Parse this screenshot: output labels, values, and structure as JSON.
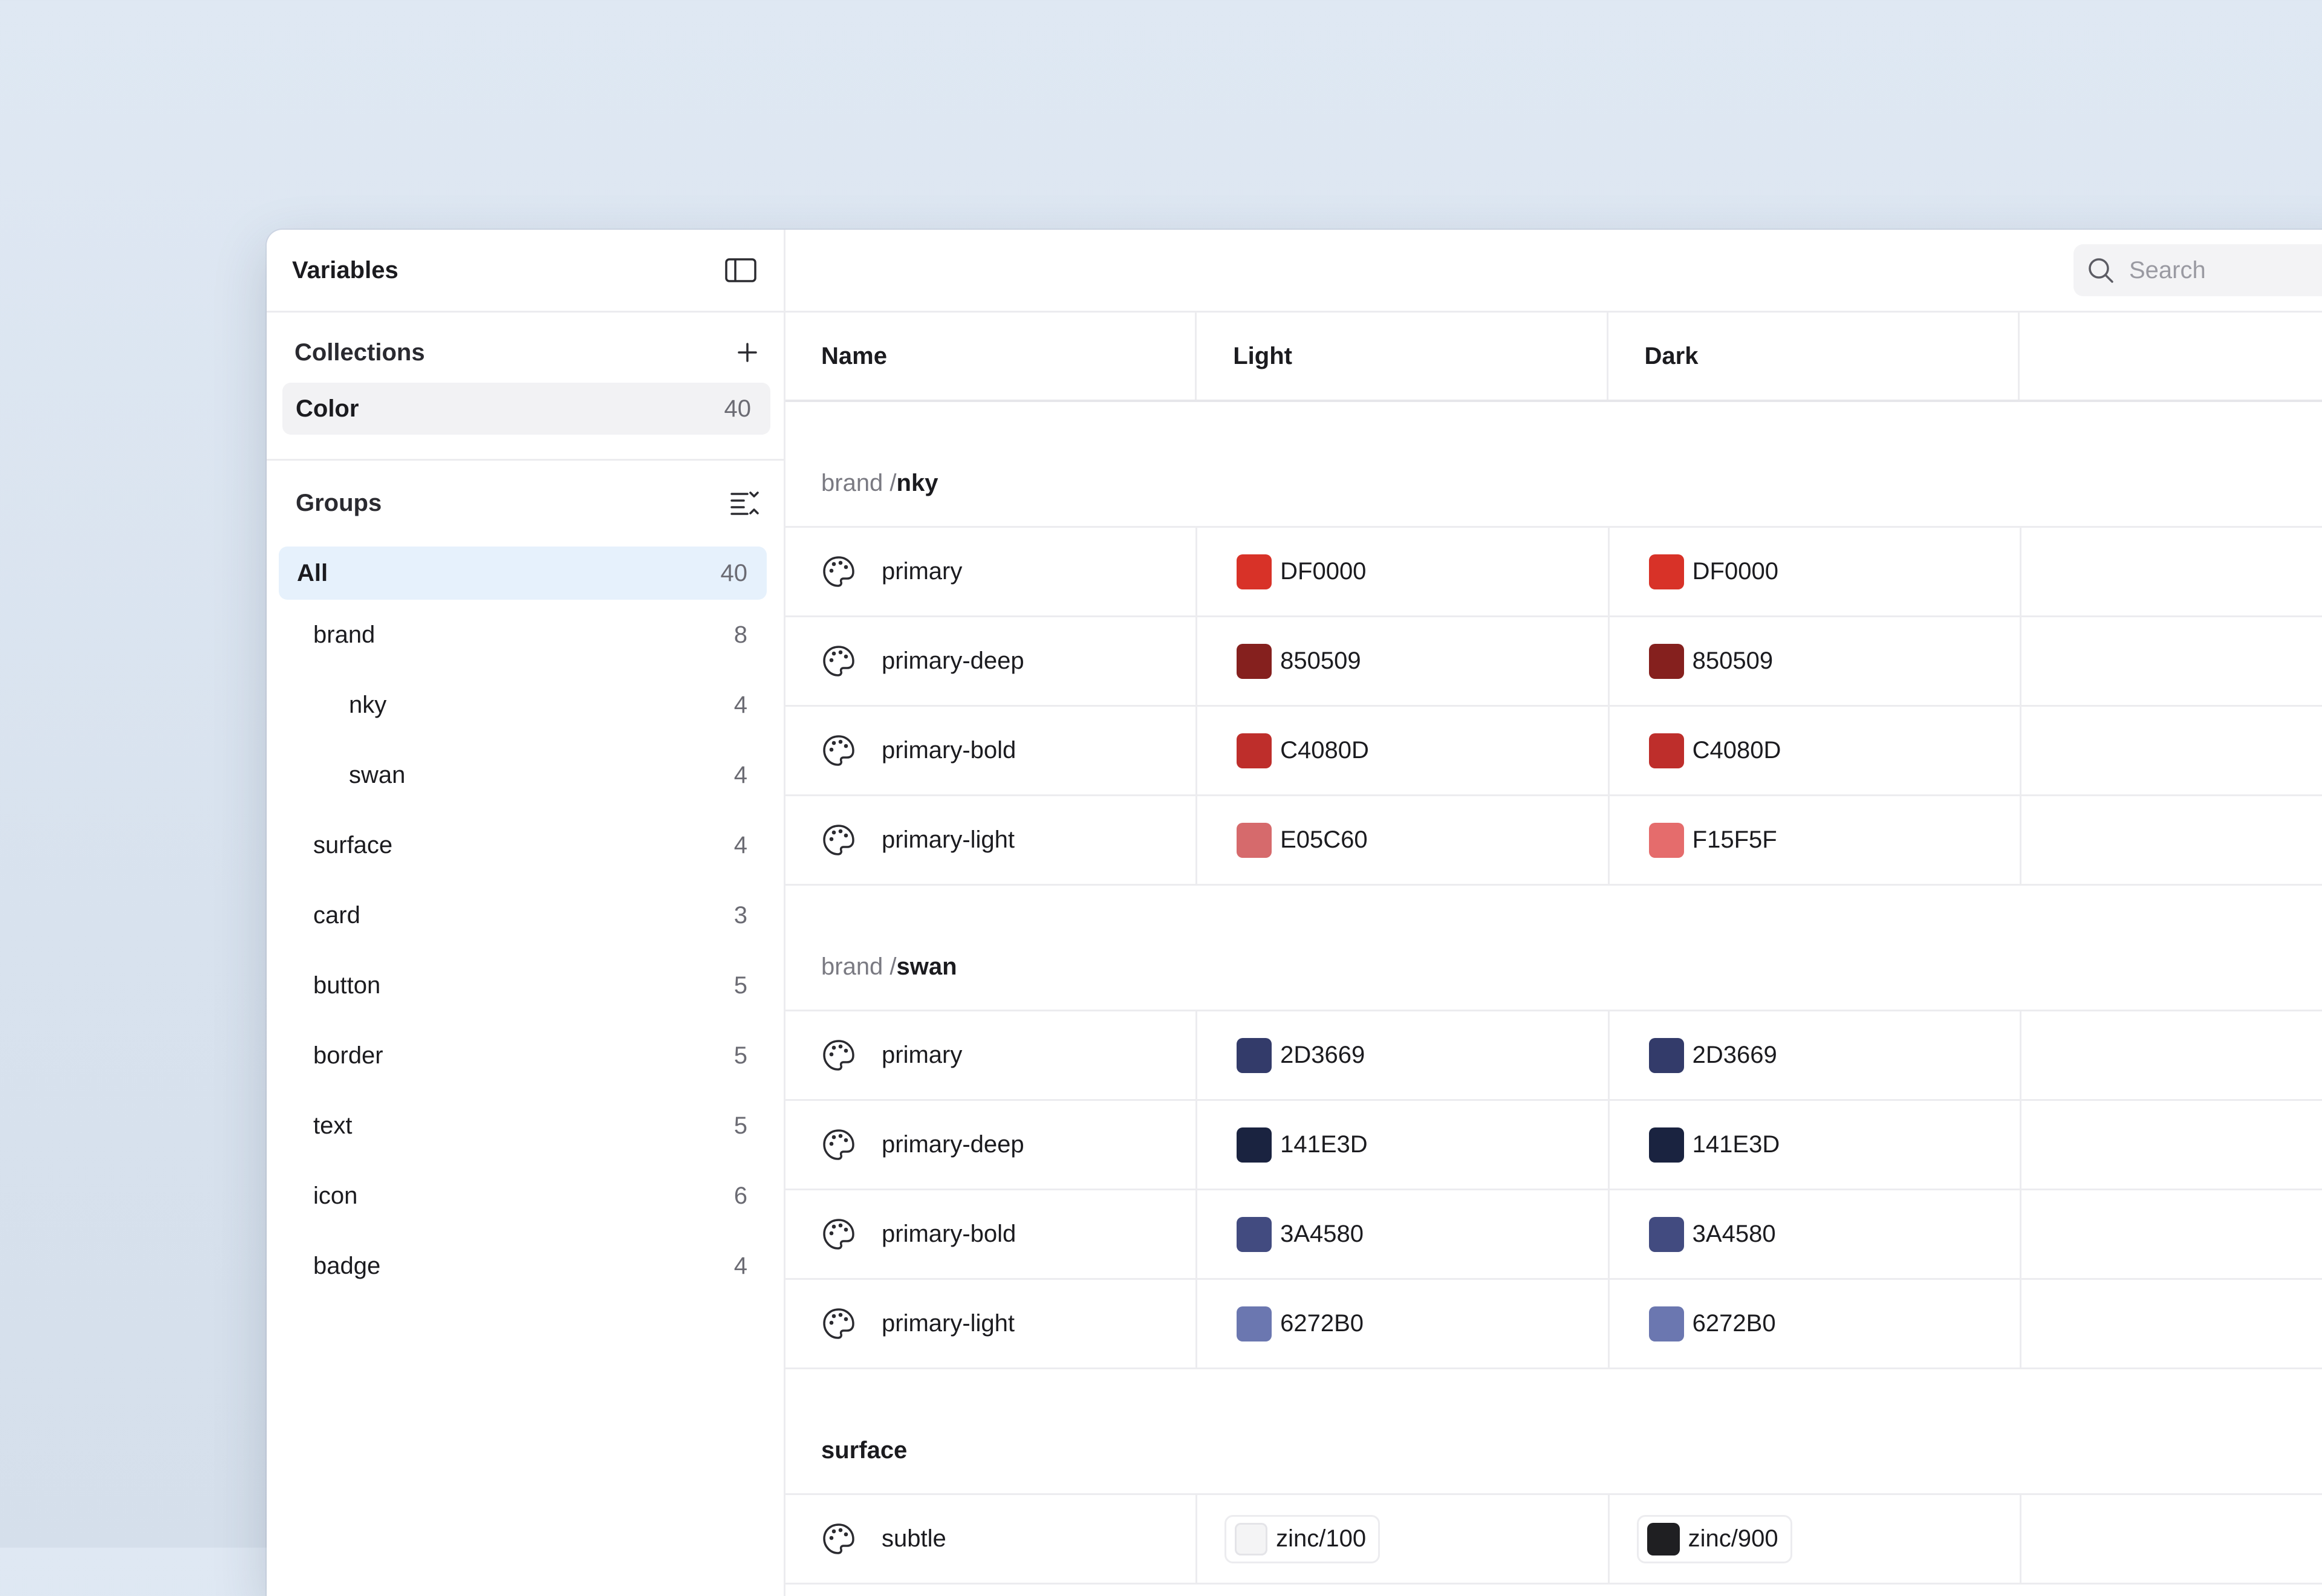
{
  "sidebar": {
    "title": "Variables",
    "collections_label": "Collections",
    "collections": [
      {
        "label": "Color",
        "count": "40"
      }
    ],
    "groups_label": "Groups",
    "groups": [
      {
        "label": "All",
        "count": "40"
      },
      {
        "label": "brand",
        "count": "8"
      },
      {
        "label": "nky",
        "count": "4"
      },
      {
        "label": "swan",
        "count": "4"
      },
      {
        "label": "surface",
        "count": "4"
      },
      {
        "label": "card",
        "count": "3"
      },
      {
        "label": "button",
        "count": "5"
      },
      {
        "label": "border",
        "count": "5"
      },
      {
        "label": "text",
        "count": "5"
      },
      {
        "label": "icon",
        "count": "6"
      },
      {
        "label": "badge",
        "count": "4"
      }
    ]
  },
  "search": {
    "placeholder": "Search"
  },
  "table": {
    "columns": [
      "Name",
      "Light",
      "Dark"
    ],
    "groups": [
      {
        "path": "brand / ",
        "name": "nky",
        "rows": [
          {
            "name": "primary",
            "light": "DF0000",
            "light_color": "#D83228",
            "dark": "DF0000",
            "dark_color": "#D83228"
          },
          {
            "name": "primary-deep",
            "light": "850509",
            "light_color": "#85201E",
            "dark": "850509",
            "dark_color": "#85201E"
          },
          {
            "name": "primary-bold",
            "light": "C4080D",
            "light_color": "#BE2E2B",
            "dark": "C4080D",
            "dark_color": "#BE2E2B"
          },
          {
            "name": "primary-light",
            "light": "E05C60",
            "light_color": "#D66A6C",
            "dark": "F15F5F",
            "dark_color": "#E56C6C"
          }
        ]
      },
      {
        "path": "brand / ",
        "name": "swan",
        "rows": [
          {
            "name": "primary",
            "light": "2D3669",
            "light_color": "#333B6A",
            "dark": "2D3669",
            "dark_color": "#333B6A"
          },
          {
            "name": "primary-deep",
            "light": "141E3D",
            "light_color": "#1A2340",
            "dark": "141E3D",
            "dark_color": "#1A2340"
          },
          {
            "name": "primary-bold",
            "light": "3A4580",
            "light_color": "#424B80",
            "dark": "3A4580",
            "dark_color": "#424B80"
          },
          {
            "name": "primary-light",
            "light": "6272B0",
            "light_color": "#6B77B0",
            "dark": "6272B0",
            "dark_color": "#6B77B0"
          }
        ]
      },
      {
        "path": "",
        "name": "surface",
        "rows": [
          {
            "name": "subtle",
            "light": "zinc/100",
            "light_color": "#F4F4F5",
            "dark": "zinc/900",
            "dark_color": "#1F1F22"
          }
        ]
      }
    ]
  }
}
